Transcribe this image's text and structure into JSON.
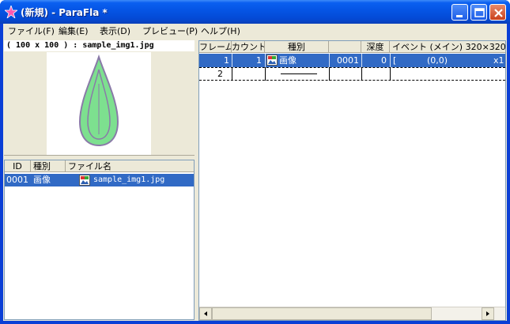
{
  "window": {
    "title": "(新規) - ParaFla *"
  },
  "menu": [
    {
      "label": "ファイル(F)"
    },
    {
      "label": "編集(E)"
    },
    {
      "label": "表示(D)"
    },
    {
      "label": "プレビュー(P)"
    },
    {
      "label": "ヘルプ(H)"
    }
  ],
  "preview": {
    "header": "( 100 x 100 ) : sample_img1.jpg"
  },
  "asset_list": {
    "columns": [
      "ID",
      "種別",
      "ファイル名"
    ],
    "rows": [
      {
        "id": "0001",
        "type": "画像",
        "filename": "sample_img1.jpg",
        "icon": "image-icon",
        "selected": true
      }
    ]
  },
  "timeline": {
    "columns": [
      "フレーム",
      "カウント",
      "種別",
      "",
      "深度",
      "イベント (メイン)  320×320"
    ],
    "rows": [
      {
        "frame": "1",
        "count": "1",
        "type": "画像",
        "id": "0001",
        "depth": "0",
        "event": "[",
        "coords": "(0,0)",
        "extra": "x1",
        "selected": true
      },
      {
        "frame": "2",
        "count": "",
        "type": "",
        "id": "",
        "depth": "",
        "event": "",
        "coords": "",
        "extra": "",
        "selected": false
      }
    ]
  },
  "colors": {
    "selection": "#316ac5",
    "leaf_fill": "#7de08f",
    "leaf_stroke": "#8a7aa8"
  }
}
